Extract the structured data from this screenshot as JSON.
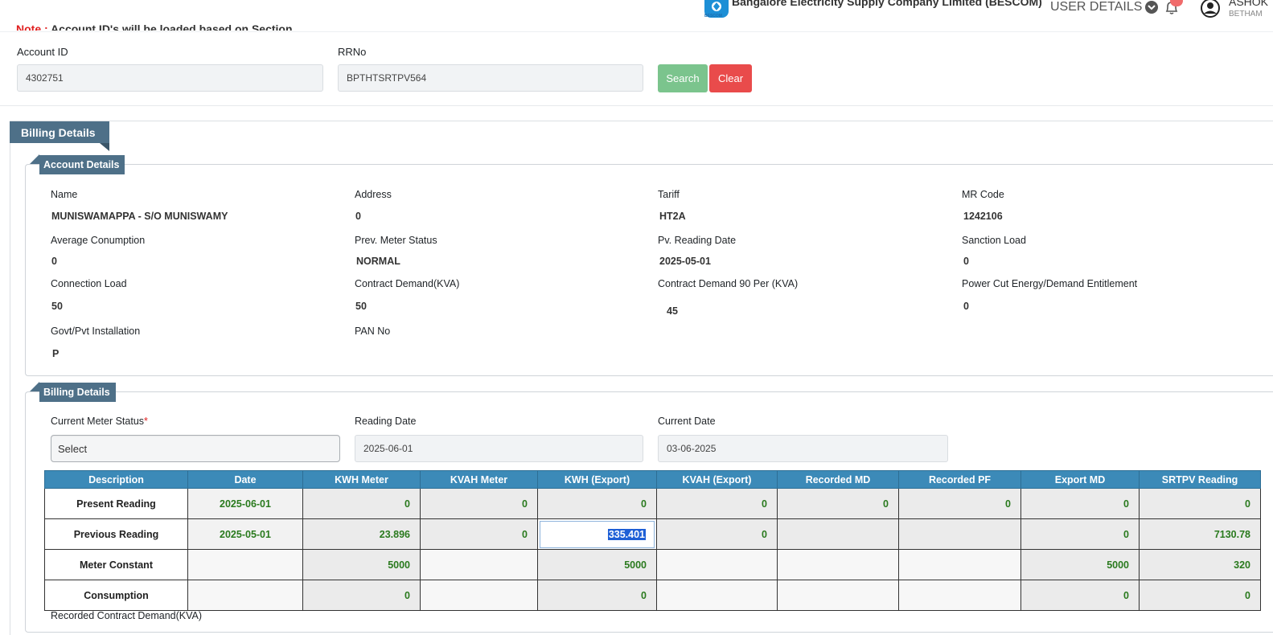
{
  "header": {
    "note_prefix": "Note :",
    "note_text": "Account ID's will be loaded based on Section",
    "company": "Bangalore Electricity Supply Company Limited (BESCOM)",
    "logo_caption": "BESCOM",
    "user_details_label": "USER DETAILS",
    "user_name": "ASHOK",
    "user_sub": "BETHAM"
  },
  "search": {
    "account_label": "Account ID",
    "account_value": "4302751",
    "rrno_label": "RRNo",
    "rrno_value": "BPTHTSRTPV564",
    "search_btn": "Search",
    "clear_btn": "Clear"
  },
  "billing_title": "Billing Details",
  "account_details": {
    "title": "Account Details",
    "fields": [
      {
        "label": "Name",
        "value": "MUNISWAMAPPA - S/O MUNISWAMY"
      },
      {
        "label": "Address",
        "value": "0"
      },
      {
        "label": "Tariff",
        "value": "HT2A"
      },
      {
        "label": "MR Code",
        "value": "1242106"
      },
      {
        "label": "Average Conumption",
        "value": "0"
      },
      {
        "label": "Prev. Meter Status",
        "value": "NORMAL"
      },
      {
        "label": "Pv. Reading Date",
        "value": "2025-05-01"
      },
      {
        "label": "Sanction Load",
        "value": "0"
      },
      {
        "label": "Connection Load",
        "value": "50"
      },
      {
        "label": "Contract Demand(KVA)",
        "value": "50"
      },
      {
        "label": "Contract Demand 90 Per (KVA)",
        "value": "45"
      },
      {
        "label": "Power Cut Energy/Demand Entitlement",
        "value": "0"
      },
      {
        "label": "Govt/Pvt Installation",
        "value": "P"
      },
      {
        "label": "PAN No",
        "value": ""
      }
    ]
  },
  "billing_details": {
    "title": "Billing Details",
    "meter_status_label": "Current Meter Status",
    "required_mark": "*",
    "meter_status_value": "Select",
    "reading_date_label": "Reading Date",
    "reading_date_value": "2025-06-01",
    "current_date_label": "Current Date",
    "current_date_value": "03-06-2025"
  },
  "readings": {
    "headers": [
      "Description",
      "Date",
      "KWH Meter",
      "KVAH Meter",
      "KWH (Export)",
      "KVAH (Export)",
      "Recorded MD",
      "Recorded PF",
      "Export MD",
      "SRTPV Reading"
    ],
    "rows": [
      [
        "Present Reading",
        "2025-06-01",
        "0",
        "0",
        "0",
        "0",
        "0",
        "0",
        "0",
        "0"
      ],
      [
        "Previous Reading",
        "2025-05-01",
        "23.896",
        "0",
        "335.401",
        "0",
        "",
        "",
        "0",
        "7130.78"
      ],
      [
        "Meter Constant",
        "",
        "5000",
        "",
        "5000",
        "",
        "",
        "",
        "5000",
        "320"
      ],
      [
        "Consumption",
        "",
        "0",
        "",
        "0",
        "",
        "",
        "",
        "0",
        "0"
      ]
    ]
  },
  "footnote": "Recorded Contract Demand(KVA)"
}
